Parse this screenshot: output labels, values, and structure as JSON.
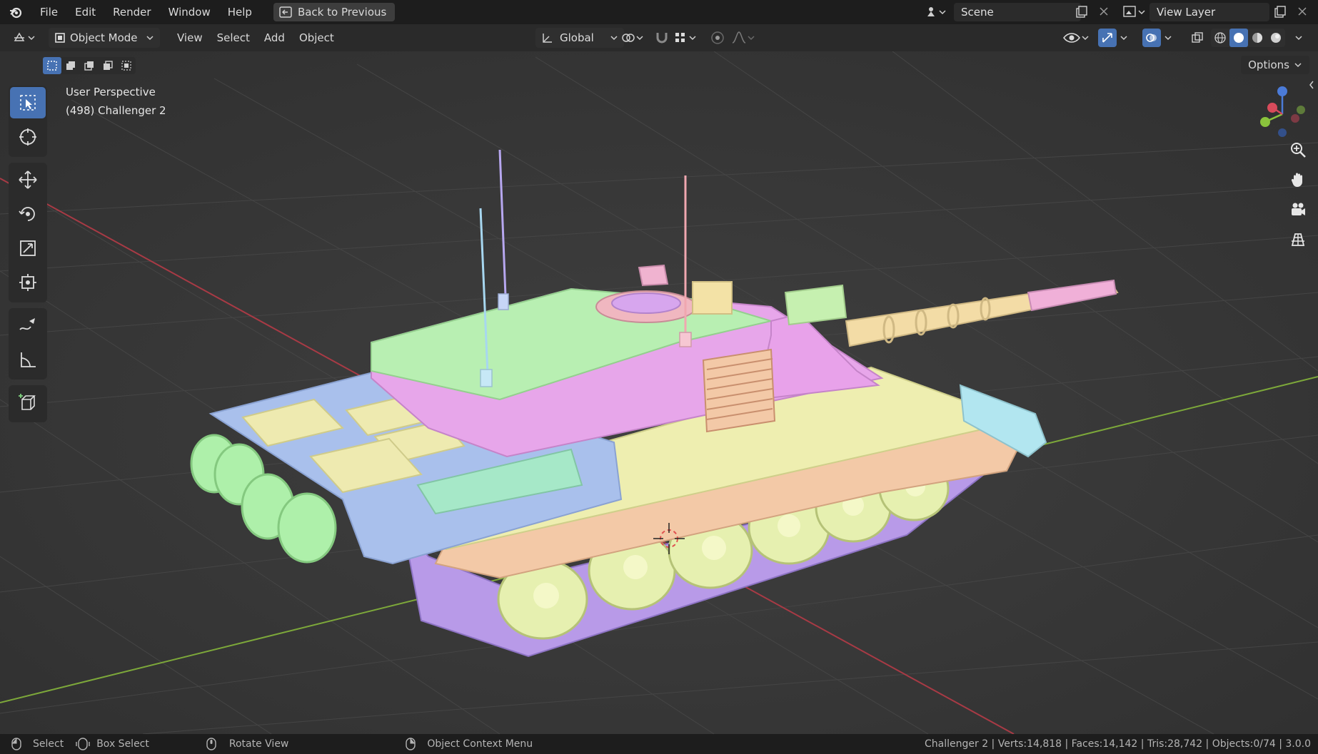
{
  "topbar": {
    "menus": [
      "File",
      "Edit",
      "Render",
      "Window",
      "Help"
    ],
    "back_label": "Back to Previous",
    "scene_label": "Scene",
    "view_layer_label": "View Layer"
  },
  "header": {
    "mode_label": "Object Mode",
    "menus": [
      "View",
      "Select",
      "Add",
      "Object"
    ],
    "orientation_label": "Global",
    "options_label": "Options"
  },
  "viewport": {
    "perspective_label": "User Perspective",
    "object_label": "(498) Challenger 2"
  },
  "statusbar": {
    "select_label": "Select",
    "box_select_label": "Box Select",
    "rotate_view_label": "Rotate View",
    "context_menu_label": "Object Context Menu",
    "stats": "Challenger 2 | Verts:14,818 | Faces:14,142 | Tris:28,742 | Objects:0/74 | 3.0.0"
  },
  "colors": {
    "accent": "#4772b3",
    "topbar_bg": "#1d1d1d",
    "header_bg": "#2a2a2a",
    "viewport_bg": "#3b3b3b",
    "x_axis": "#a83a45",
    "y_axis": "#7da83a"
  },
  "icons": {
    "app": "blender-logo-icon",
    "tools": [
      "select-box-icon",
      "cursor-icon",
      "move-icon",
      "rotate-icon",
      "scale-icon",
      "transform-icon",
      "annotate-icon",
      "measure-icon",
      "add-cube-icon"
    ],
    "nav": [
      "zoom-icon",
      "pan-hand-icon",
      "camera-icon",
      "grid-ortho-icon"
    ]
  }
}
